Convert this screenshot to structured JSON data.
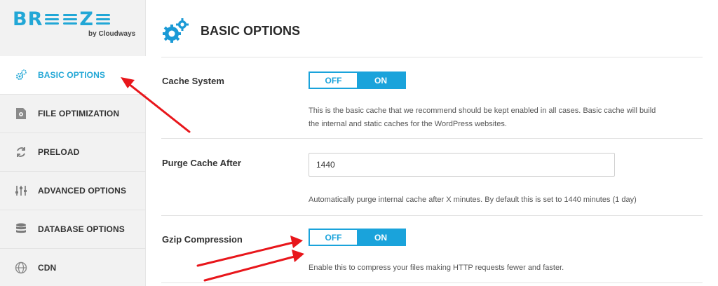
{
  "logo": {
    "text_left": "BR",
    "text_right": "Z",
    "subtitle": "by Cloudways"
  },
  "sidebar": {
    "items": [
      {
        "label": "BASIC OPTIONS",
        "icon": "gears-icon",
        "active": true
      },
      {
        "label": "FILE OPTIMIZATION",
        "icon": "file-gear-icon"
      },
      {
        "label": "PRELOAD",
        "icon": "refresh-icon"
      },
      {
        "label": "ADVANCED OPTIONS",
        "icon": "sliders-icon"
      },
      {
        "label": "DATABASE OPTIONS",
        "icon": "database-icon"
      },
      {
        "label": "CDN",
        "icon": "globe-icon"
      }
    ]
  },
  "main": {
    "title": "BASIC OPTIONS",
    "cache_system": {
      "label": "Cache System",
      "off": "OFF",
      "on": "ON",
      "state": "ON",
      "description_line1": "This is the basic cache that we recommend should be kept enabled in all cases. Basic cache will build",
      "description_line2": "the internal and static caches for the WordPress websites."
    },
    "purge_cache": {
      "label": "Purge Cache After",
      "value": "1440",
      "description": "Automatically purge internal cache after X minutes. By default this is set to 1440 minutes (1 day)"
    },
    "gzip": {
      "label": "Gzip Compression",
      "off": "OFF",
      "on": "ON",
      "state": "ON",
      "description": "Enable this to compress your files making HTTP requests fewer and faster."
    }
  },
  "colors": {
    "accent": "#1aa3db",
    "annotation": "#e8161b",
    "sidebar_bg": "#f2f2f2"
  }
}
